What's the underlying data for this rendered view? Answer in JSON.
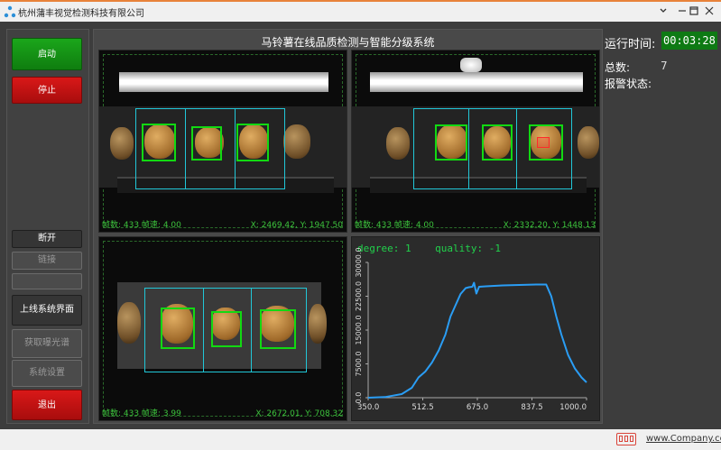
{
  "window": {
    "title": "杭州蒲丰视觉检测科技有限公司",
    "controls": [
      "minimize",
      "maximize",
      "close"
    ]
  },
  "sidebar": {
    "start_label": "启动",
    "stop_label": "停止",
    "disconnect_label": "断开",
    "connect_label": "链接",
    "blank_label": "",
    "online_ui_label": "上线系统界面",
    "get_spectrum_label": "获取曝光谱",
    "system_settings_label": "系统设置",
    "exit_label": "退出"
  },
  "main": {
    "title": "马铃薯在线品质检测与智能分级系统"
  },
  "views": [
    {
      "stat": "帧数: 433 帧速: 4.00",
      "xy": "X: 2469.42, Y: 1947.50"
    },
    {
      "stat": "帧数: 433 帧速: 4.00",
      "xy": "X: 2332.20, Y: 1448.13"
    },
    {
      "stat": "帧数: 433 帧速: 3.99",
      "xy": "X: 2672.01, Y: 708.32"
    }
  ],
  "status_panel": {
    "runtime_label": "运行时间:",
    "runtime_value": "00:03:28",
    "total_label": "总数:",
    "total_value": "7",
    "alarm_label": "报警状态:"
  },
  "footer": {
    "link_text": "www.Company.com"
  },
  "colors": {
    "accent_green": "#0e7a14",
    "start_green": "#1ba61b",
    "stop_red": "#d91818",
    "detect_green": "#12d912",
    "detect_cyan": "#21c7d8",
    "line_blue": "#2a9df4",
    "overlay_text_green": "#3cc23c"
  },
  "chart_data": {
    "type": "line",
    "title": "degree: 1    quality: -1",
    "xlim": [
      350,
      1000
    ],
    "ylim": [
      0,
      30000
    ],
    "x_ticks": [
      "350.0",
      "512.5",
      "675.0",
      "837.5",
      "1000.0"
    ],
    "y_ticks": [
      "0.0",
      "7500.0",
      "15000.0",
      "22500.0",
      "30000.0"
    ],
    "series": [
      {
        "color": "#2a9df4",
        "points": [
          [
            350,
            0
          ],
          [
            400,
            150
          ],
          [
            450,
            800
          ],
          [
            480,
            2200
          ],
          [
            500,
            4500
          ],
          [
            520,
            5800
          ],
          [
            540,
            7800
          ],
          [
            560,
            10500
          ],
          [
            580,
            14000
          ],
          [
            595,
            18000
          ],
          [
            610,
            20500
          ],
          [
            625,
            23000
          ],
          [
            640,
            24300
          ],
          [
            650,
            24500
          ],
          [
            660,
            24600
          ],
          [
            665,
            25500
          ],
          [
            672,
            23100
          ],
          [
            680,
            24600
          ],
          [
            700,
            24700
          ],
          [
            750,
            24900
          ],
          [
            800,
            25000
          ],
          [
            850,
            25100
          ],
          [
            880,
            25100
          ],
          [
            895,
            22500
          ],
          [
            910,
            18000
          ],
          [
            925,
            14000
          ],
          [
            945,
            9500
          ],
          [
            965,
            6500
          ],
          [
            985,
            4500
          ],
          [
            1000,
            3400
          ]
        ]
      }
    ]
  }
}
